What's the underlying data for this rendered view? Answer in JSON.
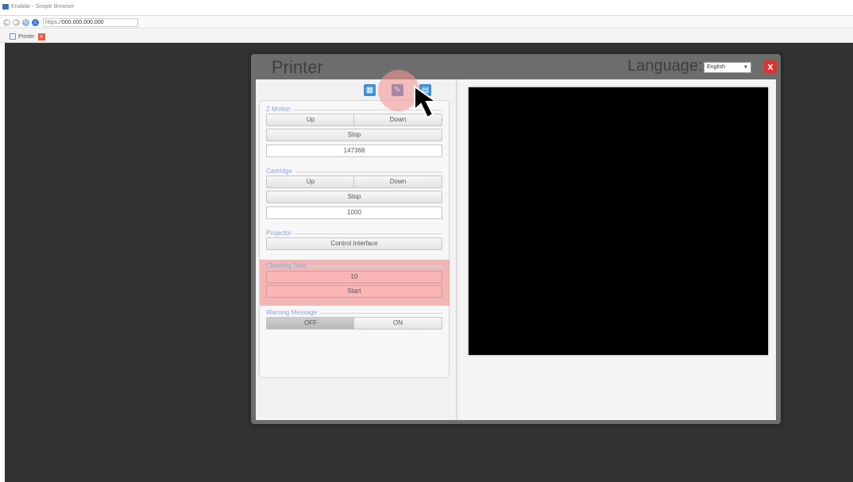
{
  "browser": {
    "window_title": "Enablar - Simple Browser",
    "address_scheme": "https://",
    "address_host": "000.000.000.000",
    "tab_label": "Printer",
    "tab_close": "x"
  },
  "dialog": {
    "title": "Printer",
    "language_label": "Language:",
    "language_value": "English",
    "close_label": "x"
  },
  "toolbar_icons": [
    "panel-icon",
    "wrench-icon",
    "book-icon"
  ],
  "z_motion": {
    "title": "Z Motion",
    "up": "Up",
    "down": "Down",
    "stop": "Stop",
    "value": "147368"
  },
  "cartridge": {
    "title": "Cartridge",
    "up": "Up",
    "down": "Down",
    "stop": "Stop",
    "value": "1000"
  },
  "projector": {
    "title": "Projector",
    "control": "Control Interface"
  },
  "cleaning_tank": {
    "title": "Cleaning Tank",
    "value": "10",
    "start": "Start"
  },
  "warning_message": {
    "title": "Warning Message",
    "off": "OFF",
    "on": "ON",
    "state": "OFF"
  },
  "colors": {
    "page_bg": "#323232",
    "dialog_frame": "#6d6d6d",
    "highlight": "#f08282",
    "close_red": "#e02f2f",
    "icon_blue": "#3b8fd6"
  }
}
